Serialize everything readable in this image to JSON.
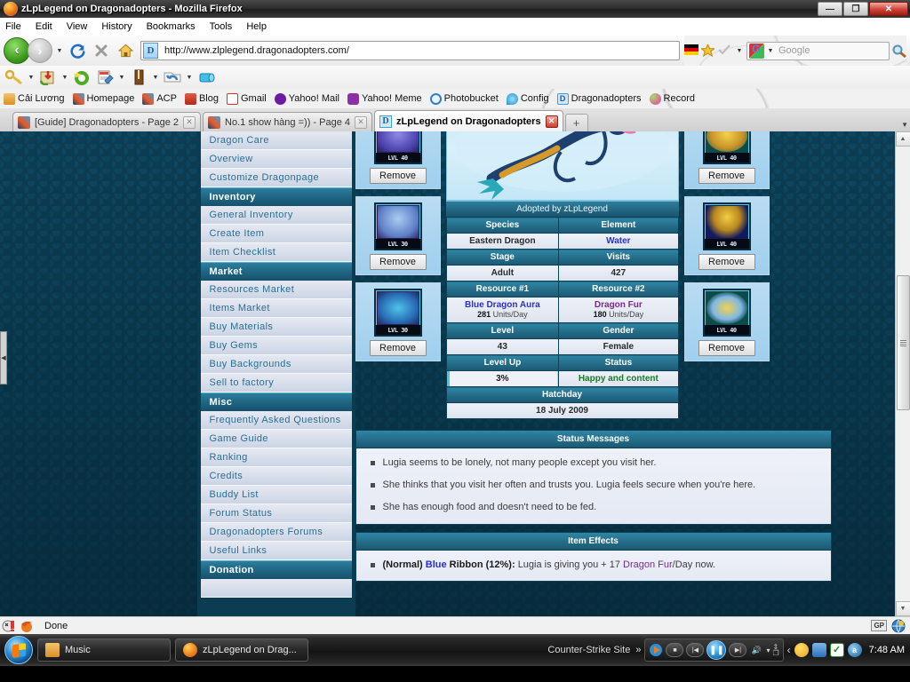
{
  "window": {
    "title": "zLpLegend on Dragonadopters - Mozilla Firefox",
    "minimize": "—",
    "maximize": "❐",
    "close": "✕"
  },
  "menubar": [
    {
      "label": "File"
    },
    {
      "label": "Edit"
    },
    {
      "label": "View"
    },
    {
      "label": "History"
    },
    {
      "label": "Bookmarks"
    },
    {
      "label": "Tools"
    },
    {
      "label": "Help"
    }
  ],
  "navbar": {
    "back_icon": "back-arrow-icon",
    "forward_icon": "forward-arrow-icon",
    "reload_icon": "reload-icon",
    "stop_icon": "stop-icon",
    "home_icon": "home-icon",
    "url": "http://www.zlplegend.dragonadopters.com/",
    "favicon_letter": "D",
    "search_placeholder": "Google"
  },
  "toolbar2_icons": [
    "key-icon",
    "download-package-icon",
    "magic-ring-icon",
    "notes-icon",
    "bookmark-icon",
    "undo-icon",
    "tube-icon"
  ],
  "bookmarks": [
    {
      "label": "Cải Lương",
      "icon": "folder-icon",
      "color": "#e8913c"
    },
    {
      "label": "Homepage",
      "icon": "rainbow-icon",
      "color": "#2a6b9c"
    },
    {
      "label": "ACP",
      "icon": "rainbow-icon",
      "color": "#2a6b9c"
    },
    {
      "label": "Blog",
      "icon": "blog-icon",
      "color": "#d43a2f"
    },
    {
      "label": "Gmail",
      "icon": "gmail-icon",
      "color": "#d93025"
    },
    {
      "label": "Yahoo! Mail",
      "icon": "yahoo-icon",
      "color": "#6d1ba0"
    },
    {
      "label": "Yahoo! Meme",
      "icon": "meme-icon",
      "color": "#8e2fa8"
    },
    {
      "label": "Photobucket",
      "icon": "photobucket-icon",
      "color": "#2f7fc4"
    },
    {
      "label": "Config",
      "icon": "flame-icon",
      "color": "#29a8e0"
    },
    {
      "label": "Dragonadopters",
      "icon": "dragonadopters-icon",
      "color": "#3f9fd8"
    },
    {
      "label": "Record",
      "icon": "record-icon",
      "color": "#7ec03a"
    }
  ],
  "tabs": [
    {
      "label": "[Guide] Dragonadopters - Page 2",
      "active": false
    },
    {
      "label": "No.1 show hàng =)) - Page 4",
      "active": false
    },
    {
      "label": "zLpLegend on Dragonadopters",
      "active": true
    }
  ],
  "newtab_label": "+",
  "sidebar": [
    {
      "type": "link",
      "label": "Dragon Care"
    },
    {
      "type": "link",
      "label": "Overview"
    },
    {
      "type": "link",
      "label": "Customize Dragonpage"
    },
    {
      "type": "head",
      "label": "Inventory"
    },
    {
      "type": "link",
      "label": "General Inventory"
    },
    {
      "type": "link",
      "label": "Create Item"
    },
    {
      "type": "link",
      "label": "Item Checklist"
    },
    {
      "type": "head",
      "label": "Market"
    },
    {
      "type": "link",
      "label": "Resources Market"
    },
    {
      "type": "link",
      "label": "Items Market"
    },
    {
      "type": "link",
      "label": "Buy Materials"
    },
    {
      "type": "link",
      "label": "Buy Gems"
    },
    {
      "type": "link",
      "label": "Buy Backgrounds"
    },
    {
      "type": "link",
      "label": "Sell to factory"
    },
    {
      "type": "head",
      "label": "Misc"
    },
    {
      "type": "link",
      "label": "Frequently Asked Questions"
    },
    {
      "type": "link",
      "label": "Game Guide"
    },
    {
      "type": "link",
      "label": "Ranking"
    },
    {
      "type": "link",
      "label": "Credits"
    },
    {
      "type": "link",
      "label": "Buddy List"
    },
    {
      "type": "link",
      "label": "Forum Status"
    },
    {
      "type": "link",
      "label": "Dragonadopters Forums"
    },
    {
      "type": "link",
      "label": "Useful Links"
    },
    {
      "type": "head",
      "label": "Donation"
    }
  ],
  "left_items": [
    {
      "name": "blue-fin-item",
      "level": "LVL 40",
      "remove_label": "Remove"
    },
    {
      "name": "blue-scarf-item",
      "level": "LVL 30",
      "remove_label": "Remove"
    },
    {
      "name": "blue-belt-item",
      "level": "LVL 30",
      "remove_label": "Remove"
    }
  ],
  "right_items": [
    {
      "name": "gold-ring-item",
      "level": "LVL 40",
      "remove_label": "Remove"
    },
    {
      "name": "gold-necklace-item",
      "level": "LVL 40",
      "remove_label": "Remove"
    },
    {
      "name": "gold-bracelet-item",
      "level": "LVL 40",
      "remove_label": "Remove"
    }
  ],
  "dragon": {
    "adopted_by": "Adopted by zLpLegend",
    "stats": [
      {
        "h1": "Species",
        "h2": "Element",
        "v1": "Eastern Dragon",
        "v2": "Water",
        "v2class": "blue"
      },
      {
        "h1": "Stage",
        "h2": "Visits",
        "v1": "Adult",
        "v2": "427"
      },
      {
        "h1": "Resource #1",
        "h2": "Resource #2",
        "r1name": "Blue Dragon Aura",
        "r1units": "281",
        "r1suffix": " Units/Day",
        "r2name": "Dragon Fur",
        "r2units": "180",
        "r2suffix": " Units/Day"
      },
      {
        "h1": "Level",
        "h2": "Gender",
        "v1": "43",
        "v2": "Female"
      },
      {
        "h1": "Level Up",
        "h2": "Status",
        "v1": "3%",
        "v2": "Happy and content",
        "v2class": "green"
      }
    ],
    "hatchday_label": "Hatchday",
    "hatchday_value": "18 July 2009",
    "levelup_percent": 3
  },
  "status_messages": {
    "title": "Status Messages",
    "items": [
      "Lugia seems to be lonely, not many people except you visit her.",
      "She thinks that you visit her often and trusts you. Lugia feels secure when you're here.",
      "She has enough food and doesn't need to be fed."
    ]
  },
  "item_effects": {
    "title": "Item Effects",
    "prefix": "(Normal) ",
    "blue_word": "Blue",
    "mid": " Ribbon (12%): ",
    "text_a": "Lugia is giving you + 17 ",
    "purple_word": "Dragon Fur",
    "text_b": "/Day now."
  },
  "statusbar": {
    "text": "Done",
    "gp_badge": "GP"
  },
  "taskbar": {
    "start_label": "start-orb",
    "items": [
      {
        "label": "Music",
        "icon": "folder-icon"
      },
      {
        "label": "zLpLegend on Drag...",
        "icon": "firefox-icon"
      }
    ],
    "deskband_label": "Counter-Strike Site",
    "deskband_chevron": "»",
    "media": {
      "stop": "■",
      "prev": "|◀",
      "play": "❚❚",
      "next": "▶|",
      "volume": "🔊",
      "volume_caret": "▾"
    },
    "tray_chevron": "‹",
    "tray_icons": [
      "smiley-icon",
      "network-icon",
      "checkmark-icon",
      "avast-icon"
    ],
    "clock": "7:48 AM"
  },
  "colors": {
    "accent_teal": "#2f85a4",
    "panel_bg": "#eef1f8",
    "sidebar_link": "#2a6f93",
    "blue_text": "#2b30c8",
    "purple_text": "#7a2a8c",
    "green_text": "#1a7a28"
  }
}
